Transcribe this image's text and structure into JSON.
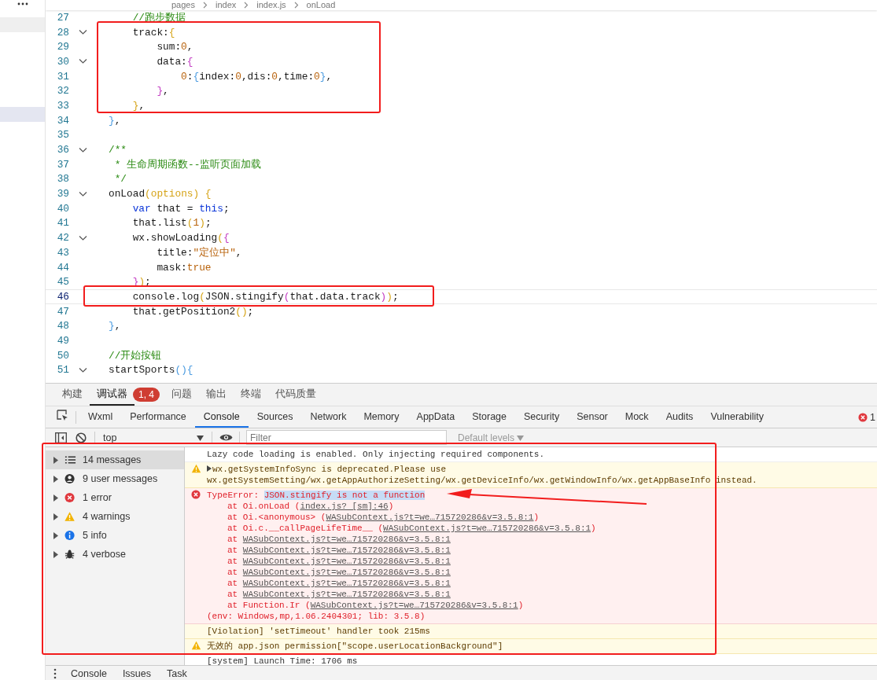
{
  "editor": {
    "breadcrumb": [
      "pages",
      "index",
      "index.js",
      "onLoad"
    ],
    "lines": [
      {
        "n": "27",
        "fold": false,
        "current": false,
        "tokens": [
          {
            "kind": "comment",
            "text": "//跑步数据"
          }
        ]
      },
      {
        "n": "28",
        "fold": true,
        "current": false,
        "tokens": [
          {
            "kind": "plain",
            "text": "track:"
          },
          {
            "kind": "brace1",
            "text": "{"
          }
        ]
      },
      {
        "n": "29",
        "fold": false,
        "current": false,
        "tokens": [
          {
            "kind": "plain",
            "text": "sum:"
          },
          {
            "kind": "literal",
            "text": "0"
          },
          {
            "kind": "plain",
            "text": ","
          }
        ]
      },
      {
        "n": "30",
        "fold": true,
        "current": false,
        "tokens": [
          {
            "kind": "plain",
            "text": "data:"
          },
          {
            "kind": "brace2",
            "text": "{"
          }
        ]
      },
      {
        "n": "31",
        "fold": false,
        "current": false,
        "tokens": [
          {
            "kind": "literal",
            "text": "0"
          },
          {
            "kind": "plain",
            "text": ":"
          },
          {
            "kind": "brace3",
            "text": "{"
          },
          {
            "kind": "plain",
            "text": "index:"
          },
          {
            "kind": "literal",
            "text": "0"
          },
          {
            "kind": "plain",
            "text": ",dis:"
          },
          {
            "kind": "literal",
            "text": "0"
          },
          {
            "kind": "plain",
            "text": ",time:"
          },
          {
            "kind": "literal",
            "text": "0"
          },
          {
            "kind": "brace3",
            "text": "}"
          },
          {
            "kind": "plain",
            "text": ","
          }
        ]
      },
      {
        "n": "32",
        "fold": false,
        "current": false,
        "tokens": [
          {
            "kind": "brace2",
            "text": "}"
          },
          {
            "kind": "plain",
            "text": ","
          }
        ]
      },
      {
        "n": "33",
        "fold": false,
        "current": false,
        "tokens": [
          {
            "kind": "brace1",
            "text": "}"
          },
          {
            "kind": "plain",
            "text": ","
          }
        ]
      },
      {
        "n": "34",
        "fold": false,
        "current": false,
        "tokens": [
          {
            "kind": "brace3",
            "text": "}"
          },
          {
            "kind": "plain",
            "text": ","
          }
        ]
      },
      {
        "n": "35",
        "fold": false,
        "current": false
      },
      {
        "n": "36",
        "fold": true,
        "current": false,
        "tokens": [
          {
            "kind": "comment",
            "text": "/**"
          }
        ]
      },
      {
        "n": "37",
        "fold": false,
        "current": false,
        "tokens": [
          {
            "kind": "comment",
            "text": " * 生命周期函数--监听页面加载"
          }
        ]
      },
      {
        "n": "38",
        "fold": false,
        "current": false,
        "tokens": [
          {
            "kind": "comment",
            "text": " */"
          }
        ]
      },
      {
        "n": "39",
        "fold": true,
        "current": false,
        "tokens": [
          {
            "kind": "plain",
            "text": "onLoad"
          },
          {
            "kind": "brace1",
            "text": "(options) {"
          }
        ]
      },
      {
        "n": "40",
        "fold": false,
        "current": false,
        "tokens": [
          {
            "kind": "keyword",
            "text": "var"
          },
          {
            "kind": "plain",
            "text": " that = "
          },
          {
            "kind": "keyword",
            "text": "this"
          },
          {
            "kind": "plain",
            "text": ";"
          }
        ]
      },
      {
        "n": "41",
        "fold": false,
        "current": false,
        "tokens": [
          {
            "kind": "plain",
            "text": "that.list"
          },
          {
            "kind": "brace1",
            "text": "("
          },
          {
            "kind": "literal",
            "text": "1"
          },
          {
            "kind": "brace1",
            "text": ")"
          },
          {
            "kind": "plain",
            "text": ";"
          }
        ]
      },
      {
        "n": "42",
        "fold": true,
        "current": false,
        "tokens": [
          {
            "kind": "plain",
            "text": "wx.showLoading"
          },
          {
            "kind": "brace1",
            "text": "("
          },
          {
            "kind": "brace2",
            "text": "{"
          }
        ]
      },
      {
        "n": "43",
        "fold": false,
        "current": false,
        "tokens": [
          {
            "kind": "plain",
            "text": "title:"
          },
          {
            "kind": "string",
            "text": "\"定位中\""
          },
          {
            "kind": "plain",
            "text": ","
          }
        ]
      },
      {
        "n": "44",
        "fold": false,
        "current": false,
        "tokens": [
          {
            "kind": "plain",
            "text": "mask:"
          },
          {
            "kind": "literal",
            "text": "true"
          }
        ]
      },
      {
        "n": "45",
        "fold": false,
        "current": false,
        "tokens": [
          {
            "kind": "brace2",
            "text": "}"
          },
          {
            "kind": "brace1",
            "text": ")"
          },
          {
            "kind": "plain",
            "text": ";"
          }
        ]
      },
      {
        "n": "46",
        "fold": false,
        "current": true,
        "tokens": [
          {
            "kind": "plain",
            "text": "console.log"
          },
          {
            "kind": "brace1",
            "text": "("
          },
          {
            "kind": "plain",
            "text": "JSON.stingify"
          },
          {
            "kind": "brace2",
            "text": "("
          },
          {
            "kind": "plain",
            "text": "that.data.track"
          },
          {
            "kind": "brace2",
            "text": ")"
          },
          {
            "kind": "brace1",
            "text": ")"
          },
          {
            "kind": "plain",
            "text": ";"
          }
        ]
      },
      {
        "n": "47",
        "fold": false,
        "current": false,
        "tokens": [
          {
            "kind": "plain",
            "text": "that.getPosition2"
          },
          {
            "kind": "brace1",
            "text": "()"
          },
          {
            "kind": "plain",
            "text": ";"
          }
        ]
      },
      {
        "n": "48",
        "fold": false,
        "current": false,
        "tokens": [
          {
            "kind": "brace3",
            "text": "}"
          },
          {
            "kind": "plain",
            "text": ","
          }
        ]
      },
      {
        "n": "49",
        "fold": false,
        "current": false
      },
      {
        "n": "50",
        "fold": false,
        "current": false,
        "tokens": [
          {
            "kind": "comment",
            "text": "//开始按钮"
          }
        ]
      },
      {
        "n": "51",
        "fold": true,
        "current": false,
        "tokens": [
          {
            "kind": "plain",
            "text": "startSports"
          },
          {
            "kind": "brace3",
            "text": "(){"
          }
        ]
      }
    ]
  },
  "devtools": {
    "top_tabs": [
      {
        "label": "构建",
        "selected": false
      },
      {
        "label": "调试器",
        "selected": true,
        "badge": "1, 4"
      },
      {
        "label": "问题",
        "selected": false
      },
      {
        "label": "输出",
        "selected": false
      },
      {
        "label": "终端",
        "selected": false
      },
      {
        "label": "代码质量",
        "selected": false
      }
    ],
    "panel_tabs": [
      {
        "label": "Wxml",
        "selected": false
      },
      {
        "label": "Performance",
        "selected": false
      },
      {
        "label": "Console",
        "selected": true
      },
      {
        "label": "Sources",
        "selected": false
      },
      {
        "label": "Network",
        "selected": false
      },
      {
        "label": "Memory",
        "selected": false
      },
      {
        "label": "AppData",
        "selected": false
      },
      {
        "label": "Storage",
        "selected": false
      },
      {
        "label": "Security",
        "selected": false
      },
      {
        "label": "Sensor",
        "selected": false
      },
      {
        "label": "Mock",
        "selected": false
      },
      {
        "label": "Audits",
        "selected": false
      },
      {
        "label": "Vulnerability",
        "selected": false
      }
    ],
    "error_count": "1",
    "toolbar": {
      "context": "top",
      "filter_placeholder": "Filter",
      "levels": "Default levels"
    },
    "sidebar": [
      {
        "kind": "all",
        "label": "14 messages",
        "selected": true
      },
      {
        "kind": "user",
        "label": "9 user messages",
        "selected": false
      },
      {
        "kind": "error",
        "label": "1 error",
        "selected": false
      },
      {
        "kind": "warning",
        "label": "4 warnings",
        "selected": false
      },
      {
        "kind": "info",
        "label": "5 info",
        "selected": false
      },
      {
        "kind": "verbose",
        "label": "4 verbose",
        "selected": false
      }
    ],
    "messages": [
      {
        "kind": "log",
        "text": "Lazy code loading is enabled. Only injecting required components."
      },
      {
        "kind": "warning",
        "expandable": true,
        "text": "wx.getSystemInfoSync is deprecated.Please use wx.getSystemSetting/wx.getAppAuthorizeSetting/wx.getDeviceInfo/wx.getWindowInfo/wx.getAppBaseInfo instead."
      },
      {
        "kind": "error",
        "error_type": "TypeError:",
        "text": "JSON.stingify is not a function",
        "selected": true,
        "stack": [
          {
            "prefix": "at Oi.onLoad (",
            "link": "index.js? [sm]:46",
            "suffix": ")"
          },
          {
            "prefix": "at Oi.<anonymous> (",
            "link": "WASubContext.js?t=we…715720286&v=3.5.8:1",
            "suffix": ")"
          },
          {
            "prefix": "at Oi.c.__callPageLifeTime__ (",
            "link": "WASubContext.js?t=we…715720286&v=3.5.8:1",
            "suffix": ")"
          },
          {
            "prefix": "at ",
            "link": "WASubContext.js?t=we…715720286&v=3.5.8:1"
          },
          {
            "prefix": "at ",
            "link": "WASubContext.js?t=we…715720286&v=3.5.8:1"
          },
          {
            "prefix": "at ",
            "link": "WASubContext.js?t=we…715720286&v=3.5.8:1"
          },
          {
            "prefix": "at ",
            "link": "WASubContext.js?t=we…715720286&v=3.5.8:1"
          },
          {
            "prefix": "at ",
            "link": "WASubContext.js?t=we…715720286&v=3.5.8:1"
          },
          {
            "prefix": "at ",
            "link": "WASubContext.js?t=we…715720286&v=3.5.8:1"
          },
          {
            "prefix": "at Function.Ir (",
            "link": "WASubContext.js?t=we…715720286&v=3.5.8:1",
            "suffix": ")"
          }
        ],
        "env": "(env: Windows,mp,1.06.2404301; lib: 3.5.8)"
      },
      {
        "kind": "violation",
        "text": "[Violation] 'setTimeout' handler took 215ms"
      },
      {
        "kind": "warning",
        "text": "无效的 app.json permission[\"scope.userLocationBackground\"]"
      },
      {
        "kind": "log",
        "text": "[system] Launch Time: 1706 ms"
      }
    ],
    "drawer_tabs": [
      "Console",
      "Issues",
      "Task"
    ]
  }
}
